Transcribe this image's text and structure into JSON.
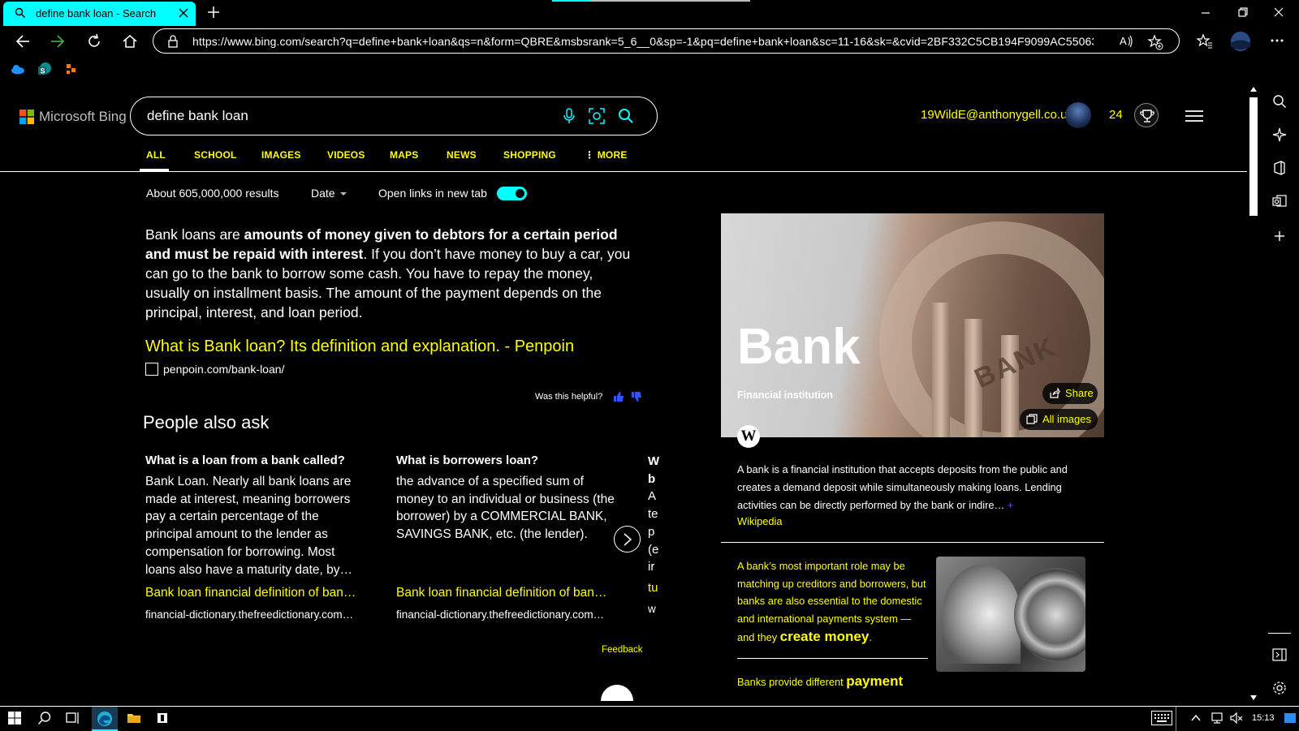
{
  "browser": {
    "tab_title": "define bank loan - Search",
    "url": "https://www.bing.com/search?q=define+bank+loan&qs=n&form=QBRE&msbsrank=5_6__0&sp=-1&pq=define+bank+loan&sc=11-16&sk=&cvid=2BF332C5CB194F9099AC550638C...",
    "accent": "#00ffff"
  },
  "bing": {
    "logo": "Microsoft Bing",
    "query": "define bank loan",
    "user_email": "19WildE@anthonygell.co.uk",
    "points": "24",
    "scopes": [
      "ALL",
      "SCHOOL",
      "IMAGES",
      "VIDEOS",
      "MAPS",
      "NEWS",
      "SHOPPING",
      "MORE"
    ],
    "results_count": "About 605,000,000 results",
    "date_filter": "Date",
    "open_links_label": "Open links in new tab",
    "open_links_enabled": true
  },
  "answer": {
    "intro": "Bank loans are ",
    "bold": "amounts of money given to debtors for a certain period and must be repaid with interest",
    "rest": ". If you don’t have money to buy a car, you can go to the bank to borrow some cash. You have to repay the money, usually on installment basis. The amount of the payment depends on the principal, interest, and loan period.",
    "link_title": "What is Bank loan? Its definition and explanation. - Penpoin",
    "source": "penpoin.com/bank-loan/",
    "helpful": "Was this helpful?"
  },
  "people_also_ask": {
    "title": "People also ask",
    "cards": [
      {
        "question": "What is a loan from a bank called?",
        "answer": "Bank Loan. Nearly all bank loans are made at interest, meaning borrowers pay a certain percentage of the principal amount to the lender as compensation for borrowing. Most loans also have a maturity date, by…",
        "link": "Bank loan financial definition of ban…",
        "source": "financial-dictionary.thefreedictionary.com…"
      },
      {
        "question": "What is borrowers loan?",
        "answer": "the advance of a specified sum of money to an individual or business (the borrower) by a COMMERCIAL BANK, SAVINGS BANK, etc. (the lender).",
        "link": "Bank loan financial definition of ban…",
        "source": "financial-dictionary.thefreedictionary.com…"
      }
    ],
    "peek_lines": [
      "W",
      "b",
      "A",
      "te",
      "p",
      "(e",
      "ir"
    ],
    "peek_link": "tu",
    "peek_source": "w",
    "feedback": "Feedback"
  },
  "knowledge_panel": {
    "title": "Bank",
    "subtitle": "Financial institution",
    "hero_carving": "BANK",
    "share": "Share",
    "all_images": "All images",
    "wiki_badge": "W",
    "description": "A bank is a financial institution that accepts deposits from the public and creates a demand deposit while simultaneously making loans. Lending activities can be directly performed by the bank or indire…",
    "more_symbol": "+",
    "source": "Wikipedia",
    "fact1_text": "A bank’s most important role may be matching up creditors and borrowers, but banks are also essential to the domestic and international payments system —and they ",
    "fact1_emphasis": "create money",
    "fact1_end": ".",
    "fact2_text": "Banks provide different ",
    "fact2_emphasis": "payment"
  },
  "taskbar": {
    "time": "15:13"
  }
}
